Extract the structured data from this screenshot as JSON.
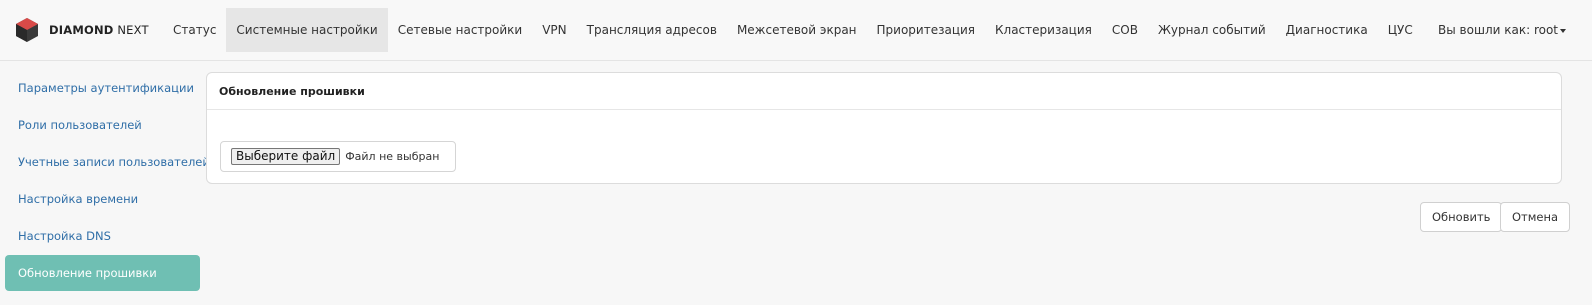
{
  "brand": {
    "name_bold": "DIAMOND",
    "name_rest": " NEXT",
    "logo_icon": "diamond-logo-icon"
  },
  "nav": {
    "items": [
      {
        "label": "Статус"
      },
      {
        "label": "Системные настройки"
      },
      {
        "label": "Сетевые настройки"
      },
      {
        "label": "VPN"
      },
      {
        "label": "Трансляция адресов"
      },
      {
        "label": "Межсетевой экран"
      },
      {
        "label": "Приоритезация"
      },
      {
        "label": "Кластеризация"
      },
      {
        "label": "СОВ"
      },
      {
        "label": "Журнал событий"
      },
      {
        "label": "Диагностика"
      },
      {
        "label": "ЦУС"
      }
    ],
    "active": "Системные настройки"
  },
  "user": {
    "label": "Вы вошли как: root",
    "icon": "caret-down-icon"
  },
  "sidebar": {
    "items": [
      {
        "label": "Параметры аутентификации"
      },
      {
        "label": "Роли пользователей"
      },
      {
        "label": "Учетные записи пользователей"
      },
      {
        "label": "Настройка времени"
      },
      {
        "label": "Настройка DNS"
      },
      {
        "label": "Обновление прошивки"
      }
    ],
    "active": "Обновление прошивки"
  },
  "panel": {
    "title": "Обновление прошивки",
    "file": {
      "button_label": "Выберите файл",
      "status": "Файл не выбран"
    }
  },
  "actions": {
    "update_label": "Обновить",
    "cancel_label": "Отмена"
  },
  "colors": {
    "accent": "#6fbfb3",
    "link": "#2f6ea7",
    "logo": "#d94a48"
  }
}
